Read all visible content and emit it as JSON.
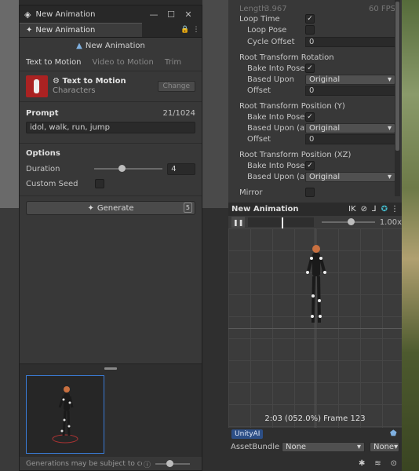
{
  "left_window": {
    "title": "New Animation",
    "tab_label": "New Animation",
    "header": "New Animation",
    "modes": [
      "Text to Motion",
      "Video to Motion",
      "Trim"
    ],
    "model": {
      "name": "Text to Motion",
      "category": "Characters",
      "change_label": "Change"
    },
    "prompt": {
      "label": "Prompt",
      "counter": "21/1024",
      "value": "idol, walk, run, jump"
    },
    "options": {
      "label": "Options",
      "duration_label": "Duration",
      "duration_value": "4",
      "duration_fraction": 0.4,
      "custom_seed_label": "Custom Seed",
      "custom_seed_checked": false
    },
    "generate": {
      "label": "Generate",
      "count": "5"
    },
    "footer_text": "Generations may be subject to co..."
  },
  "inspector": {
    "length_label": "Length",
    "length_value": "3.967",
    "fps": "60 FPS",
    "loop_time": "Loop Time",
    "loop_pose": "Loop Pose",
    "cycle_offset": "Cycle Offset",
    "cycle_offset_value": "0",
    "rot_section": "Root Transform Rotation",
    "rot_bake": "Bake Into Pose",
    "rot_based": "Based Upon",
    "rot_based_value": "Original",
    "rot_offset": "Offset",
    "rot_offset_value": "0",
    "posy_section": "Root Transform Position (Y)",
    "posy_bake": "Bake Into Pose",
    "posy_based": "Based Upon (at St",
    "posy_based_value": "Original",
    "posy_offset": "Offset",
    "posy_offset_value": "0",
    "posxz_section": "Root Transform Position (XZ)",
    "posxz_bake": "Bake Into Pose",
    "posxz_based": "Based Upon (at St",
    "posxz_based_value": "Original",
    "mirror": "Mirror"
  },
  "anim_preview": {
    "title": "New Animation",
    "ik_label": "IK",
    "speed": "1.00x",
    "frame_info": "2:03 (052.0%) Frame 123"
  },
  "asset": {
    "tag": "UnityAI",
    "bundle_label": "AssetBundle",
    "bundle_value": "None",
    "variant_value": "None"
  },
  "colors": {
    "accent": "#3a7bd5",
    "panel": "#383838"
  }
}
